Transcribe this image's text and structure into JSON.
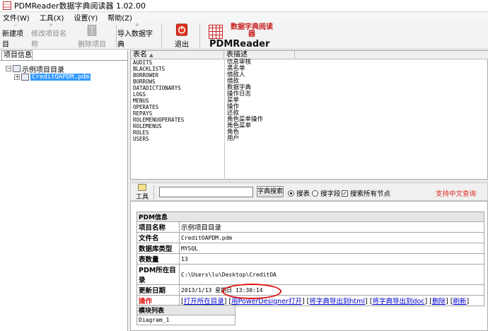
{
  "window": {
    "title": "PDMReader数据字典阅读器 1.02.00"
  },
  "menu": [
    "文件(W)",
    "工具(X)",
    "设置(Y)",
    "帮助(Z)"
  ],
  "toolbar": {
    "new_project": "新建项目",
    "edit_project": "修改项目名称",
    "delete_project": "删除项目",
    "import_dict": "导入数据字典",
    "exit": "退出"
  },
  "logo": {
    "cn": "数据字典阅读器",
    "en": "PDMReader"
  },
  "project_panel": {
    "tab": "项目信息",
    "root": "示例项目目录",
    "child": "CreditOAPDM.pdm"
  },
  "table_grid": {
    "headers": [
      "表名",
      "表描述"
    ],
    "rows": [
      [
        "AUDITS",
        "信息审核"
      ],
      [
        "BLACKLISTS",
        "黑名单"
      ],
      [
        "BORROWER",
        "借款人"
      ],
      [
        "BORROWS",
        "借款"
      ],
      [
        "DATADICTIONARYS",
        "数据字典"
      ],
      [
        "LOGS",
        "操作日志"
      ],
      [
        "MENUS",
        "菜单"
      ],
      [
        "OPERATES",
        "操作"
      ],
      [
        "REPAYS",
        "还款"
      ],
      [
        "ROLEMENUOPERATES",
        "角色菜单操作"
      ],
      [
        "ROLEMENUS",
        "角色菜单"
      ],
      [
        "ROLES",
        "角色"
      ],
      [
        "USERS",
        "用户"
      ]
    ]
  },
  "search": {
    "tool_label": "工具",
    "input_value": "",
    "button": "字典搜索",
    "opt_table": "搜表",
    "opt_field": "搜字段",
    "opt_all": "搜索所有节点",
    "cn_support": "支持中文查询"
  },
  "pdm_info": {
    "header": "PDM信息",
    "rows": [
      {
        "label": "项目名称",
        "value": "示例项目目录"
      },
      {
        "label": "文件名",
        "value": "CreditOAPDM.pdm"
      },
      {
        "label": "数据库类型",
        "value": "MYSQL"
      },
      {
        "label": "表数量",
        "value": "13"
      },
      {
        "label": "PDM所在目录",
        "value": "C:\\Users\\lu\\Desktop\\CreditOA"
      },
      {
        "label": "更新日期",
        "value": "2013/1/13 星期日 13:30:14"
      }
    ],
    "op_label": "操作",
    "links": [
      "打开所在目录",
      "用PowerDesigner打开",
      "将字典导出到html",
      "将字典导出到doc",
      "删除",
      "刷新"
    ]
  },
  "modules": {
    "header": "模块列表",
    "items": [
      "Diagram_1"
    ]
  },
  "colors": {
    "accent_red": "#e0261b",
    "selection": "#3399ff",
    "link": "#0000cc"
  }
}
